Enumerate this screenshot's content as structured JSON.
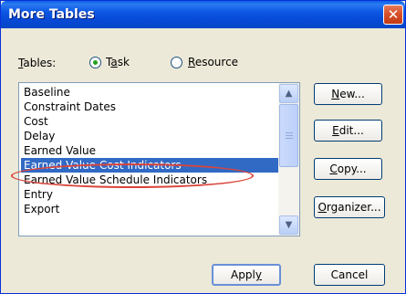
{
  "window": {
    "title": "More Tables",
    "close_symbol": "✕"
  },
  "tables": {
    "label": "Tables:",
    "options": [
      {
        "label": "Task",
        "selected": true
      },
      {
        "label": "Resource",
        "selected": false
      }
    ]
  },
  "list": {
    "items": [
      "Baseline",
      "Constraint Dates",
      "Cost",
      "Delay",
      "Earned Value",
      "Earned Value Cost Indicators",
      "Earned Value Schedule Indicators",
      "Entry",
      "Export"
    ],
    "selected": "Earned Value Cost Indicators",
    "scroll_up_symbol": "▲",
    "scroll_down_symbol": "▼"
  },
  "buttons": {
    "new": "New...",
    "edit": "Edit...",
    "copy": "Copy...",
    "organizer": "Organizer...",
    "apply": "Apply",
    "cancel": "Cancel"
  }
}
